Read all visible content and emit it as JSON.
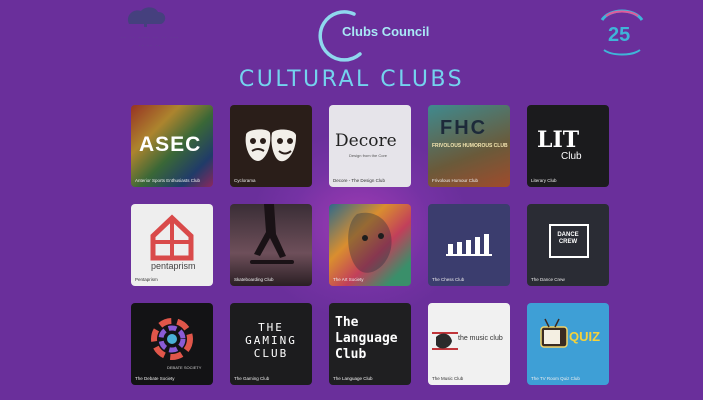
{
  "header": {
    "council_name": "Clubs Council",
    "anniversary_number": "25",
    "page_title": "CULTURAL CLUBS"
  },
  "colors": {
    "background": "#6a2f9b",
    "title": "#74d3ee",
    "council_text": "#a9e8f6"
  },
  "clubs": [
    {
      "caption": "Anterior Sports Enthusiasts Club",
      "logo": "ASEC"
    },
    {
      "caption": "Cyclorama",
      "logo": ""
    },
    {
      "caption": "Decore - The Design Club",
      "logo": "Decore",
      "sublogo": "Design from the Core"
    },
    {
      "caption": "Frivolous Humour Club",
      "logo": "FHC",
      "sublogo": "FRIVOLOUS HUMOROUS CLUB"
    },
    {
      "caption": "Literary Club",
      "logo": "LIT",
      "sublogo": "Club"
    },
    {
      "caption": "Pentaprism",
      "logo": "pentaprism"
    },
    {
      "caption": "Skateboarding Club",
      "logo": ""
    },
    {
      "caption": "The Art Society",
      "logo": ""
    },
    {
      "caption": "The Chess Club",
      "logo": ""
    },
    {
      "caption": "The Dance Crew",
      "logo": "DANCE CREW"
    },
    {
      "caption": "The Debate Society",
      "logo": "DEBATE SOCIETY"
    },
    {
      "caption": "The Gaming Club",
      "logo": "THE GAMING CLUB"
    },
    {
      "caption": "The Language Club",
      "logo": "The Language Club"
    },
    {
      "caption": "The Music Club",
      "logo": "the music club"
    },
    {
      "caption": "The TV Room Quiz Club",
      "logo": "QUIZ"
    }
  ]
}
